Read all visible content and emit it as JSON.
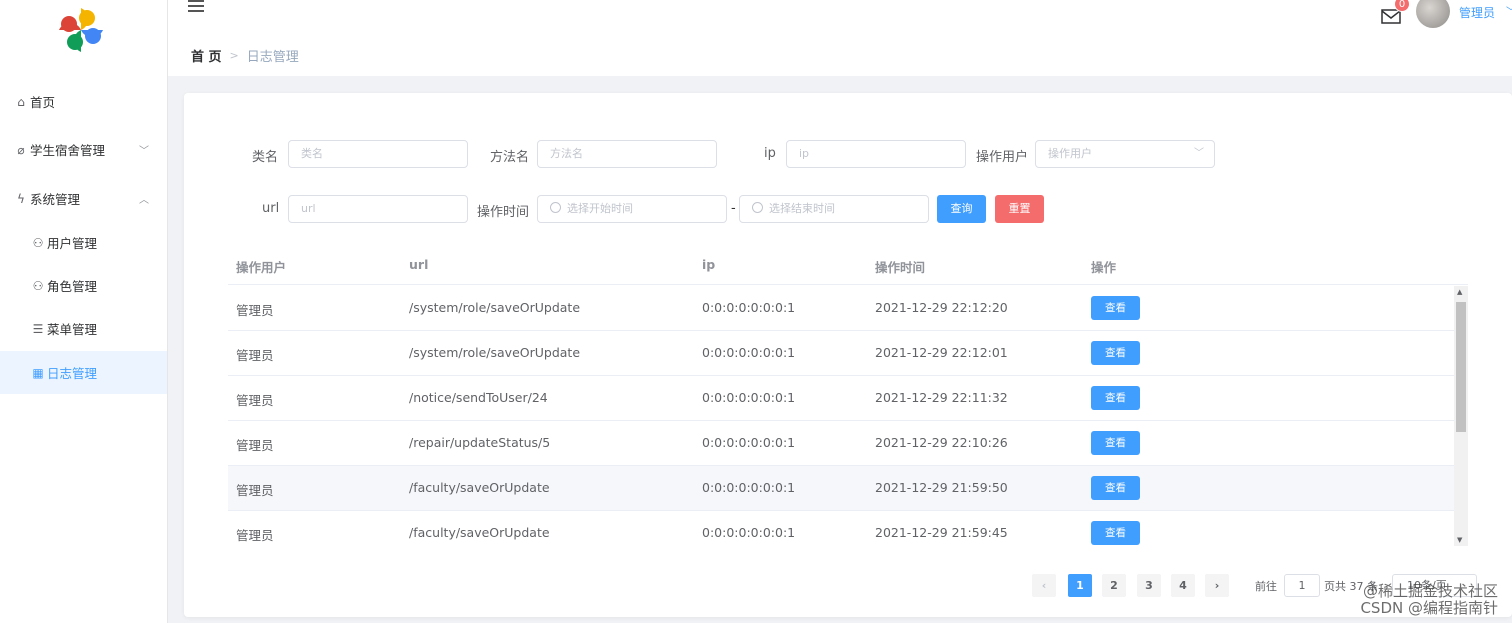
{
  "sidebar": {
    "items": [
      {
        "label": "首页",
        "icon": "home-icon"
      },
      {
        "label": "学生宿舍管理",
        "icon": "paperclip-icon",
        "arrow": "﹀"
      },
      {
        "label": "系统管理",
        "icon": "lightning-icon",
        "arrow": "︿"
      },
      {
        "label": "用户管理",
        "icon": "user-icon"
      },
      {
        "label": "角色管理",
        "icon": "users-icon"
      },
      {
        "label": "菜单管理",
        "icon": "menu-icon"
      },
      {
        "label": "日志管理",
        "icon": "table-icon",
        "active": true
      }
    ]
  },
  "header": {
    "breadcrumb": {
      "home": "首 页",
      "current": "日志管理"
    },
    "notification_count": "0",
    "user_name": "管理员"
  },
  "filters": {
    "class_label": "类名",
    "class_placeholder": "类名",
    "method_label": "方法名",
    "method_placeholder": "方法名",
    "ip_label": "ip",
    "ip_placeholder": "ip",
    "user_label": "操作用户",
    "user_placeholder": "操作用户",
    "url_label": "url",
    "url_placeholder": "url",
    "time_label": "操作时间",
    "start_placeholder": "选择开始时间",
    "end_placeholder": "选择结束时间",
    "range_sep": "-",
    "query_button": "查询",
    "reset_button": "重置"
  },
  "table": {
    "headers": [
      "操作用户",
      "url",
      "ip",
      "操作时间",
      "操作"
    ],
    "view_label": "查看",
    "rows": [
      {
        "user": "管理员",
        "url": "/system/role/saveOrUpdate",
        "ip": "0:0:0:0:0:0:0:1",
        "time": "2021-12-29 22:12:20"
      },
      {
        "user": "管理员",
        "url": "/system/role/saveOrUpdate",
        "ip": "0:0:0:0:0:0:0:1",
        "time": "2021-12-29 22:12:01"
      },
      {
        "user": "管理员",
        "url": "/notice/sendToUser/24",
        "ip": "0:0:0:0:0:0:0:1",
        "time": "2021-12-29 22:11:32"
      },
      {
        "user": "管理员",
        "url": "/repair/updateStatus/5",
        "ip": "0:0:0:0:0:0:0:1",
        "time": "2021-12-29 22:10:26"
      },
      {
        "user": "管理员",
        "url": "/faculty/saveOrUpdate",
        "ip": "0:0:0:0:0:0:0:1",
        "time": "2021-12-29 21:59:50"
      },
      {
        "user": "管理员",
        "url": "/faculty/saveOrUpdate",
        "ip": "0:0:0:0:0:0:0:1",
        "time": "2021-12-29 21:59:45"
      }
    ]
  },
  "pagination": {
    "prev": "‹",
    "next": "›",
    "pages": [
      "1",
      "2",
      "3",
      "4"
    ],
    "current_page": "1",
    "goto_label": "前往",
    "goto_value": "1",
    "total_text": "页共 37 条",
    "page_size": "10条/页"
  },
  "watermark": {
    "line1": "@稀土掘金技术社区",
    "line2": "CSDN @编程指南针"
  }
}
